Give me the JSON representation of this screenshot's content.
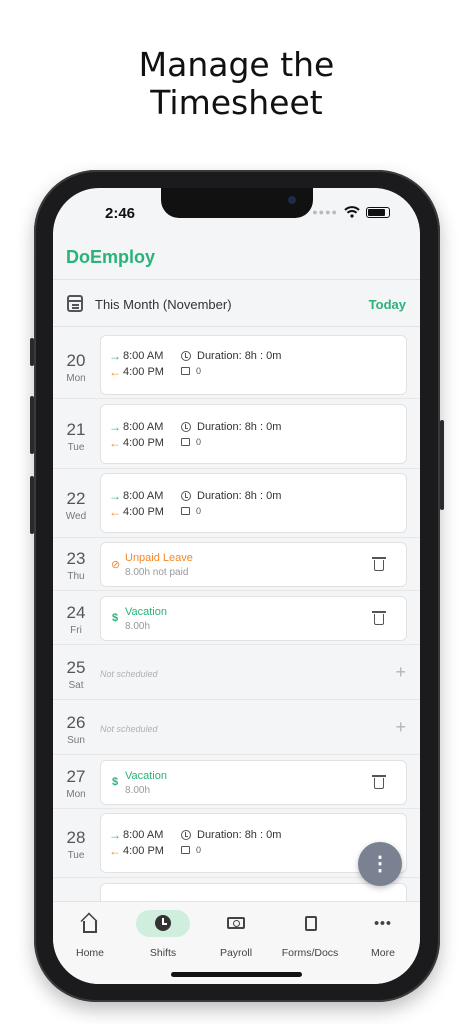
{
  "headline": {
    "line1": "Manage the",
    "line2": "Timesheet"
  },
  "status": {
    "time": "2:46"
  },
  "app": {
    "brand": "DoEmploy"
  },
  "month": {
    "label": "This Month (November)",
    "today": "Today"
  },
  "days": [
    {
      "num": "20",
      "name": "Mon",
      "kind": "shift",
      "in": "8:00 AM",
      "out": "4:00 PM",
      "duration": "Duration: 8h : 0m",
      "notes": "0"
    },
    {
      "num": "21",
      "name": "Tue",
      "kind": "shift",
      "in": "8:00 AM",
      "out": "4:00 PM",
      "duration": "Duration: 8h : 0m",
      "notes": "0"
    },
    {
      "num": "22",
      "name": "Wed",
      "kind": "shift",
      "in": "8:00 AM",
      "out": "4:00 PM",
      "duration": "Duration: 8h : 0m",
      "notes": "0"
    },
    {
      "num": "23",
      "name": "Thu",
      "kind": "unpaid",
      "title": "Unpaid Leave",
      "sub": "8.00h not paid"
    },
    {
      "num": "24",
      "name": "Fri",
      "kind": "vacation",
      "title": "Vacation",
      "sub": "8.00h"
    },
    {
      "num": "25",
      "name": "Sat",
      "kind": "empty",
      "text": "Not scheduled"
    },
    {
      "num": "26",
      "name": "Sun",
      "kind": "empty",
      "text": "Not scheduled"
    },
    {
      "num": "27",
      "name": "Mon",
      "kind": "vacation",
      "title": "Vacation",
      "sub": "8.00h"
    },
    {
      "num": "28",
      "name": "Tue",
      "kind": "shift",
      "in": "8:00 AM",
      "out": "4:00 PM",
      "duration": "Duration: 8h : 0m",
      "notes": "0"
    }
  ],
  "tabs": [
    {
      "label": "Home",
      "icon": "home-icon"
    },
    {
      "label": "Shifts",
      "icon": "clock-icon",
      "active": true
    },
    {
      "label": "Payroll",
      "icon": "payroll-icon"
    },
    {
      "label": "Forms/Docs",
      "icon": "documents-icon"
    },
    {
      "label": "More",
      "icon": "more-icon"
    }
  ],
  "colors": {
    "brand": "#2bb27b",
    "clock_out": "#f08a2c",
    "active_tab": "#cfeedd",
    "fab": "#7a8191"
  }
}
